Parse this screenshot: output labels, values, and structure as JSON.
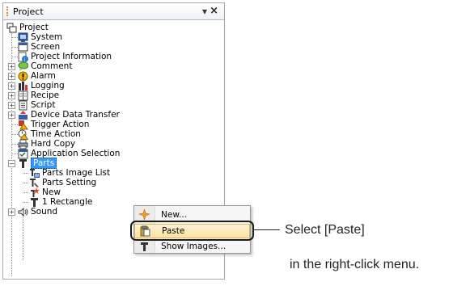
{
  "panel": {
    "title": "Project",
    "pin_glyph": "⬇",
    "close_glyph": "✕"
  },
  "tree": {
    "root": "Project",
    "items": [
      {
        "label": "System",
        "icon": "system-icon"
      },
      {
        "label": "Screen",
        "icon": "screen-icon"
      },
      {
        "label": "Project Information",
        "icon": "project-information-icon"
      },
      {
        "label": "Comment",
        "icon": "comment-icon",
        "expander": "+"
      },
      {
        "label": "Alarm",
        "icon": "alarm-icon",
        "expander": "+"
      },
      {
        "label": "Logging",
        "icon": "logging-icon",
        "expander": "+"
      },
      {
        "label": "Recipe",
        "icon": "recipe-icon",
        "expander": "+"
      },
      {
        "label": "Script",
        "icon": "script-icon",
        "expander": "+"
      },
      {
        "label": "Device Data Transfer",
        "icon": "device-data-transfer-icon",
        "expander": "+"
      },
      {
        "label": "Trigger Action",
        "icon": "trigger-action-icon"
      },
      {
        "label": "Time Action",
        "icon": "time-action-icon"
      },
      {
        "label": "Hard Copy",
        "icon": "hard-copy-icon"
      },
      {
        "label": "Application Selection",
        "icon": "application-selection-icon"
      },
      {
        "label": "Parts",
        "icon": "parts-icon",
        "expander": "-",
        "selected": true
      },
      {
        "label": "Parts Image List",
        "icon": "parts-image-list-icon"
      },
      {
        "label": "Parts Setting",
        "icon": "parts-setting-icon"
      },
      {
        "label": "New",
        "icon": "new-part-icon"
      },
      {
        "label": "1 Rectangle",
        "icon": "rectangle-part-icon"
      },
      {
        "label": "Sound",
        "icon": "sound-icon",
        "expander": "+"
      }
    ]
  },
  "context_menu": {
    "items": [
      {
        "label": "New...",
        "icon": "new-icon"
      },
      {
        "label": "Paste",
        "icon": "paste-icon",
        "highlighted": true
      },
      {
        "label": "Show Images...",
        "icon": "show-images-icon"
      }
    ]
  },
  "annotation": {
    "line1": "Select [Paste]",
    "line2": "in the right-click menu."
  },
  "colors": {
    "selection": "#3399ff",
    "highlight": "#ffe3a0",
    "grip": "#e08a1a"
  }
}
